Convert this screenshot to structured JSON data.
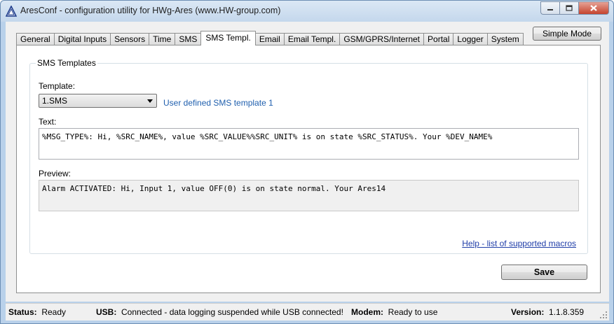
{
  "window": {
    "title": "AresConf - configuration utility for HWg-Ares (www.HW-group.com)"
  },
  "tabs": [
    "General",
    "Digital Inputs",
    "Sensors",
    "Time",
    "SMS",
    "SMS Templ.",
    "Email",
    "Email Templ.",
    "GSM/GPRS/Internet",
    "Portal",
    "Logger",
    "System"
  ],
  "active_tab": "SMS Templ.",
  "simple_mode_label": "Simple Mode",
  "group": {
    "title": "SMS Templates",
    "template_label": "Template:",
    "template_value": "1.SMS",
    "template_description": "User defined SMS template 1",
    "text_label": "Text:",
    "text_value": "%MSG_TYPE%: Hi, %SRC_NAME%, value %SRC_VALUE%%SRC_UNIT% is on state %SRC_STATUS%. Your %DEV_NAME%",
    "preview_label": "Preview:",
    "preview_value": "Alarm ACTIVATED: Hi, Input 1, value OFF(0) is on state normal. Your Ares14",
    "help_link": "Help - list of supported macros"
  },
  "save_label": "Save",
  "status": {
    "status_label": "Status:",
    "status_value": "Ready",
    "usb_label": "USB:",
    "usb_value": "Connected - data logging suspended while USB connected!",
    "modem_label": "Modem:",
    "modem_value": "Ready to use",
    "version_label": "Version:",
    "version_value": "1.1.8.359"
  },
  "icons": [
    "app-logo-icon",
    "minimize-icon",
    "maximize-icon",
    "close-icon",
    "dropdown-arrow-icon",
    "resize-grip-icon"
  ]
}
